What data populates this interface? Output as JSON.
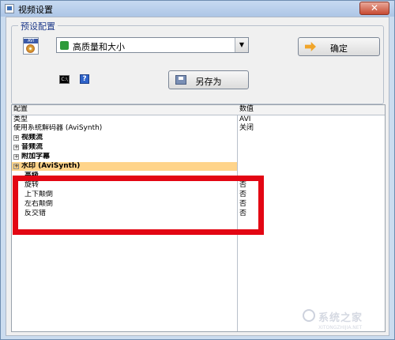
{
  "window": {
    "title": "视频设置",
    "close_glyph": "✕"
  },
  "preset": {
    "group_label": "预设配置",
    "format_icon_text": "AVI",
    "selected_value": "高质量和大小",
    "ok_label": "确定",
    "save_as_label": "另存为",
    "cmd_icon_text": "C:\\",
    "help_icon_text": "?"
  },
  "grid": {
    "col_config": "配置",
    "col_value": "数值",
    "rows": [
      {
        "label": "类型",
        "value": "AVI"
      },
      {
        "label": "使用系统解码器 (AviSynth)",
        "value": "关闭"
      },
      {
        "label": "视频流",
        "value": ""
      },
      {
        "label": "音频流",
        "value": ""
      },
      {
        "label": "附加字幕",
        "value": ""
      },
      {
        "label": "水印 (AviSynth)",
        "value": ""
      },
      {
        "label": "高级",
        "value": ""
      },
      {
        "label": "旋转",
        "value": "否"
      },
      {
        "label": "上下颠倒",
        "value": "否"
      },
      {
        "label": "左右颠倒",
        "value": "否"
      },
      {
        "label": "反交错",
        "value": "否"
      }
    ]
  },
  "expander_glyph": "+",
  "watermark": {
    "text": "系统之家",
    "url": "XITONGZHIJIA.NET"
  },
  "colors": {
    "highlight_box": "#e30613",
    "selected_row": "#ffd48a"
  }
}
